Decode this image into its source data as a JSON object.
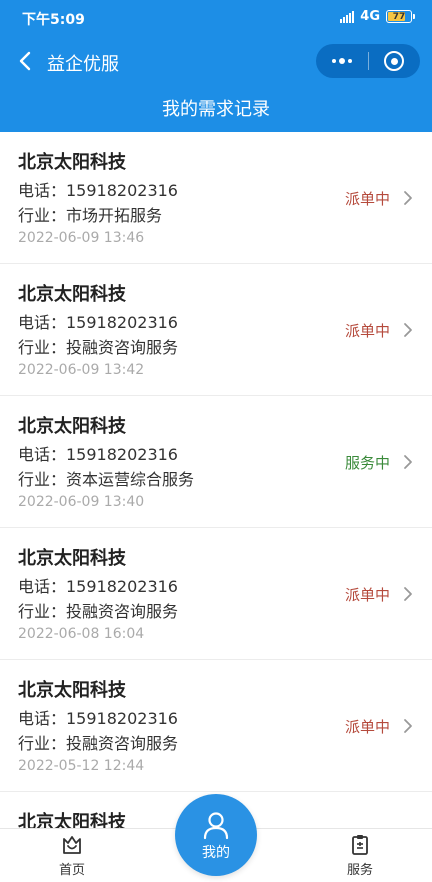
{
  "status_bar": {
    "time": "下午5:09",
    "network": "4G",
    "battery": "77"
  },
  "nav": {
    "title": "益企优服"
  },
  "subheader": {
    "title": "我的需求记录"
  },
  "records": [
    {
      "company": "北京太阳科技",
      "phone": "电话：15918202316",
      "industry": "行业：市场开拓服务",
      "date": "2022-06-09 13:46",
      "status": "派单中"
    },
    {
      "company": "北京太阳科技",
      "phone": "电话：15918202316",
      "industry": "行业：投融资咨询服务",
      "date": "2022-06-09 13:42",
      "status": "派单中"
    },
    {
      "company": "北京太阳科技",
      "phone": "电话：15918202316",
      "industry": "行业：资本运营综合服务",
      "date": "2022-06-09 13:40",
      "status": "服务中"
    },
    {
      "company": "北京太阳科技",
      "phone": "电话：15918202316",
      "industry": "行业：投融资咨询服务",
      "date": "2022-06-08 16:04",
      "status": "派单中"
    },
    {
      "company": "北京太阳科技",
      "phone": "电话：15918202316",
      "industry": "行业：投融资咨询服务",
      "date": "2022-05-12 12:44",
      "status": "派单中"
    },
    {
      "company": "北京太阳科技"
    }
  ],
  "tabbar": {
    "home": "首页",
    "mine": "我的",
    "service": "服务"
  },
  "colors": {
    "primary": "#1d8ee6",
    "dispatching": "#b54a3c",
    "serving": "#3a8a3a"
  }
}
